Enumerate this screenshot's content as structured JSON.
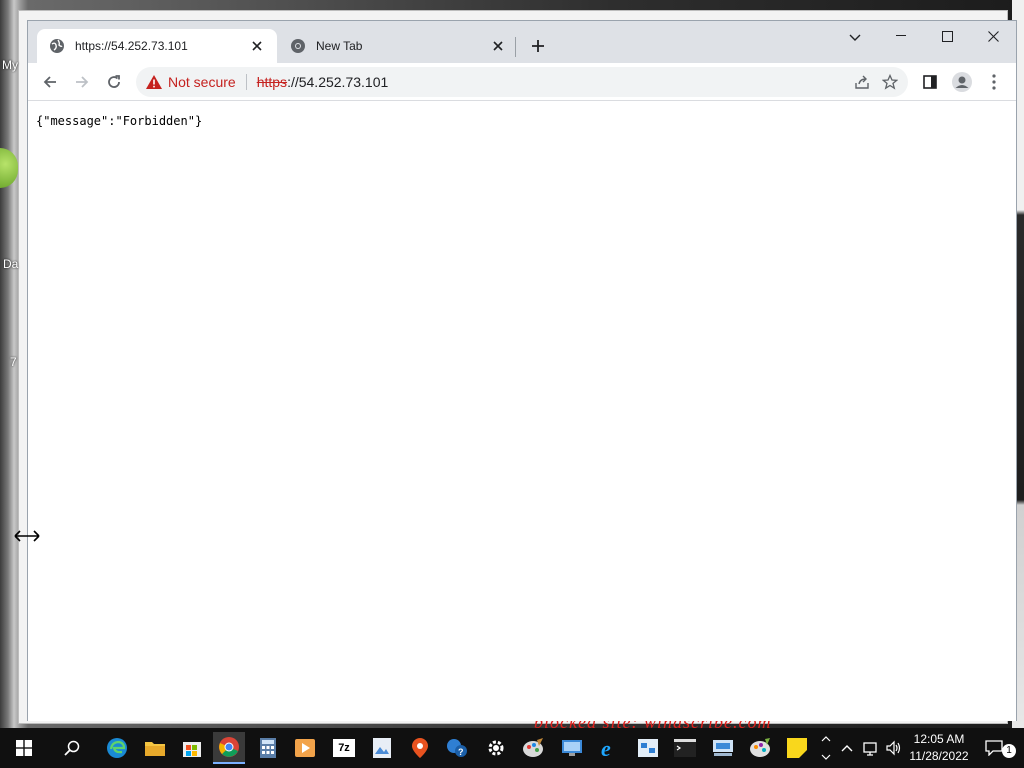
{
  "desktop": {
    "labels": [
      "My",
      "Da",
      "7"
    ],
    "bg_text": "blocked site: windscribe.com"
  },
  "browser": {
    "tabs": [
      {
        "title": "https://54.252.73.101",
        "active": true
      },
      {
        "title": "New Tab",
        "active": false
      }
    ],
    "omnibox": {
      "security_label": "Not secure",
      "url_scheme": "https",
      "url_rest": "://54.252.73.101"
    },
    "page_content": "{\"message\":\"Forbidden\"}"
  },
  "taskbar": {
    "time": "12:05 AM",
    "date": "11/28/2022",
    "notification_count": "1",
    "app_7zip_label": "7z"
  },
  "colors": {
    "tabstrip": "#dee1e6",
    "not_secure": "#c5221f",
    "taskbar": "#101010"
  }
}
